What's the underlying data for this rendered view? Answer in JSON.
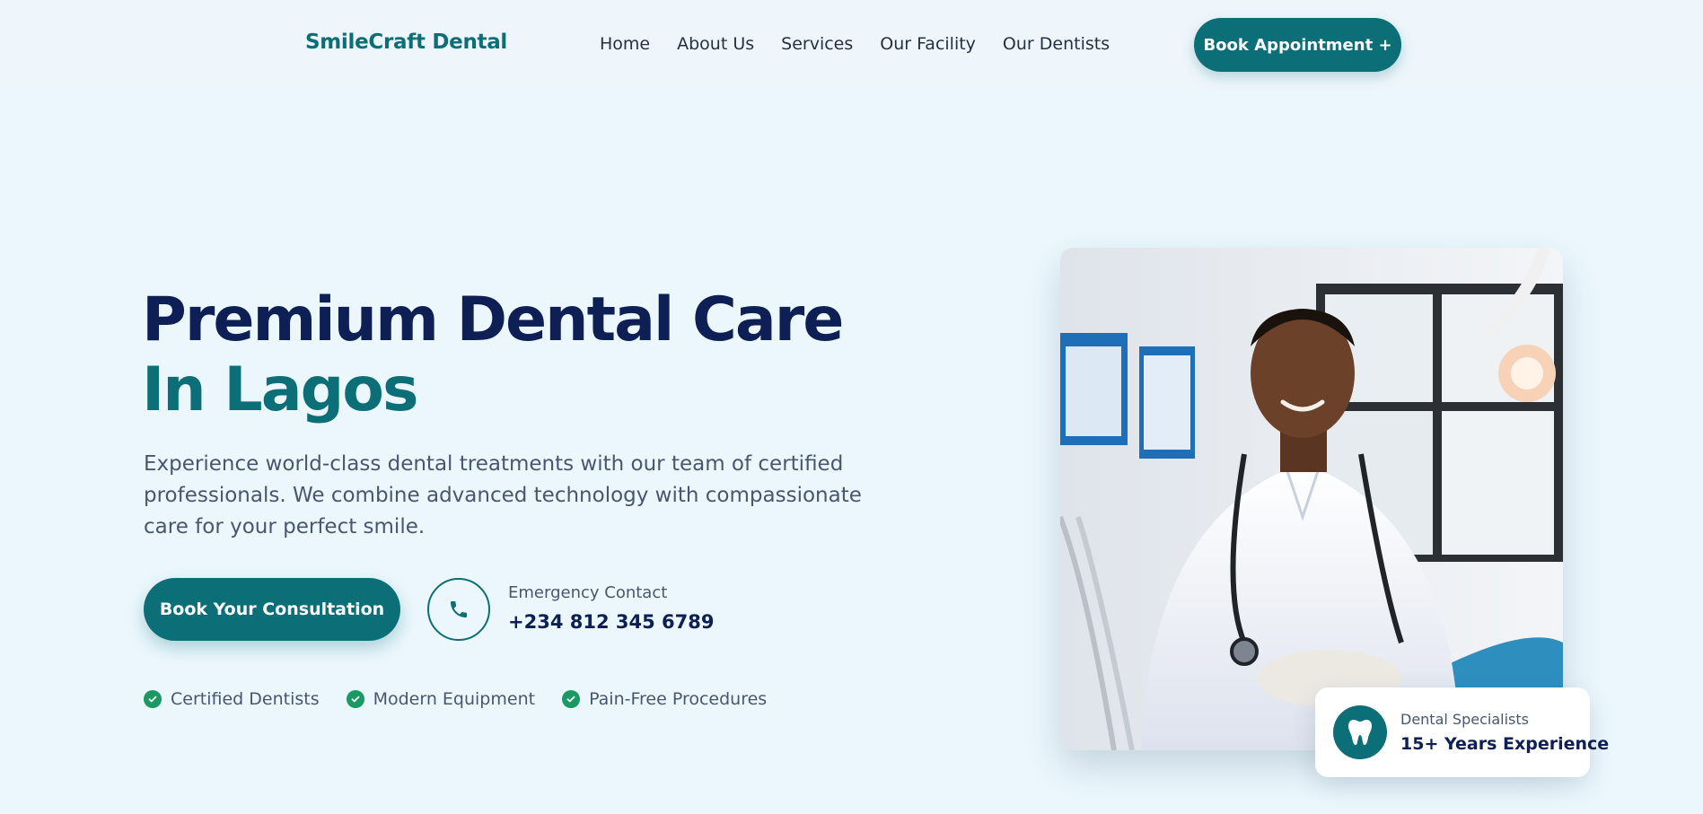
{
  "nav": {
    "brand": "SmileCraft Dental",
    "links": [
      "Home",
      "About Us",
      "Services",
      "Our Facility",
      "Our Dentists"
    ],
    "cta_label": "Book Appointment +"
  },
  "hero": {
    "title_line1": "Premium Dental Care",
    "title_line2": "In Lagos",
    "description": "Experience world-class dental treatments with our team of certified professionals. We combine advanced technology with compassionate care for your perfect smile.",
    "cta_label": "Book Your Consultation",
    "emergency_label": "Emergency Contact",
    "emergency_phone": "+234 812 345 6789",
    "features": [
      "Certified Dentists",
      "Modern Equipment",
      "Pain-Free Procedures"
    ]
  },
  "badge": {
    "line1": "Dental Specialists",
    "line2": "15+ Years Experience"
  },
  "icons": {
    "phone": "phone-icon",
    "check": "check-circle-icon",
    "tooth": "tooth-icon"
  },
  "colors": {
    "primary": "#0c6f77",
    "heading": "#0d1f54",
    "background": "#ebf7fd",
    "check": "#1a9a62"
  }
}
